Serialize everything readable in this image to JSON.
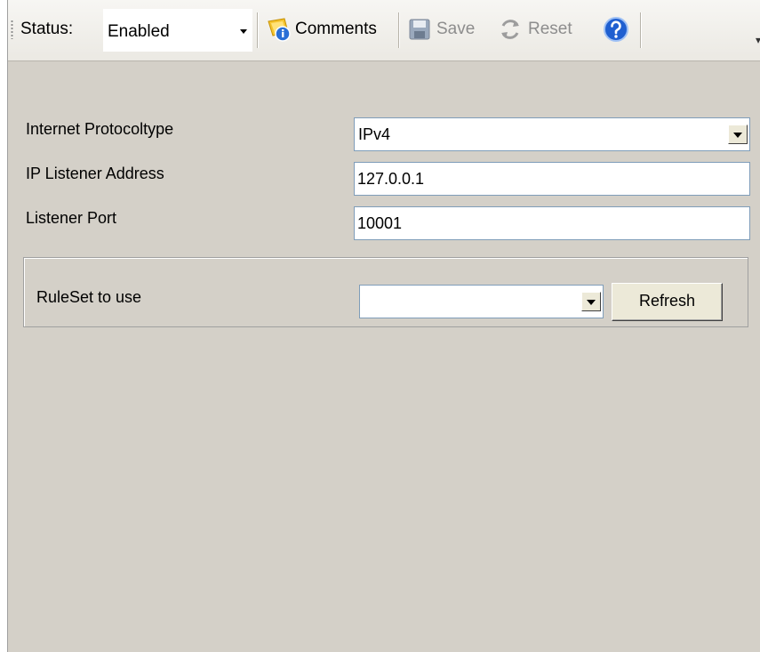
{
  "toolbar": {
    "status_label": "Status:",
    "status_value": "Enabled",
    "comments_label": "Comments",
    "save_label": "Save",
    "reset_label": "Reset",
    "icons": {
      "comments": "comments-icon",
      "save": "save-icon",
      "reset": "reset-icon",
      "help": "help-icon"
    }
  },
  "form": {
    "protocol": {
      "label": "Internet Protocoltype",
      "value": "IPv4"
    },
    "address": {
      "label": "IP Listener Address",
      "value": "127.0.0.1"
    },
    "port": {
      "label": "Listener Port",
      "value": "10001"
    },
    "ruleset": {
      "label": "RuleSet to use",
      "value": "",
      "refresh_label": "Refresh"
    }
  },
  "colors": {
    "background": "#d4d0c8",
    "input_border": "#7f9db9",
    "help_blue": "#1f5fd0"
  }
}
